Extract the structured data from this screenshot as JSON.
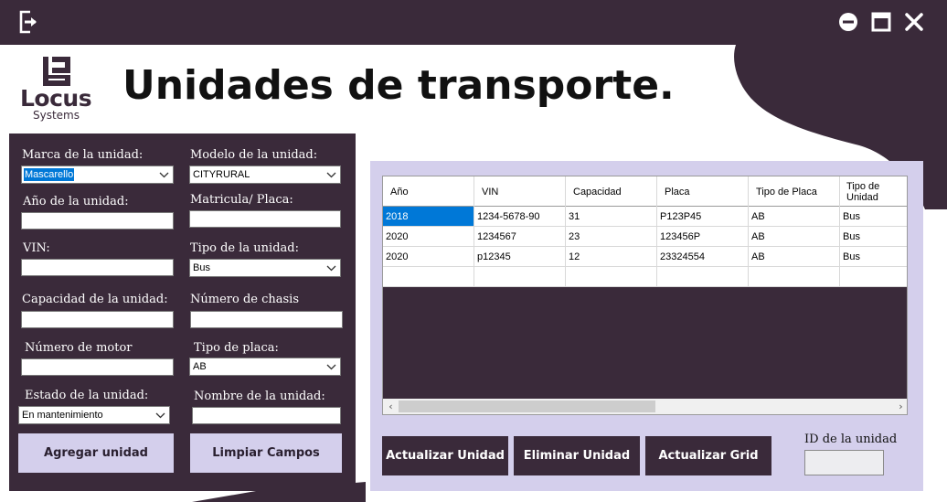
{
  "window": {
    "title_icons": [
      "logout-icon",
      "minimize-icon",
      "maximize-icon",
      "close-icon"
    ],
    "colors": {
      "titlebar": "#3a2a3a",
      "accent_light": "#d4cfec",
      "selection": "#0078d7"
    }
  },
  "logo": {
    "word": "Locus",
    "sub": "Systems"
  },
  "header": {
    "title": "Unidades de transporte."
  },
  "form": {
    "marca_label": "Marca de la unidad:",
    "marca_value": "Mascarello",
    "modelo_label": "Modelo de la unidad:",
    "modelo_value": "CITYRURAL",
    "anio_label": "Año de la unidad:",
    "anio_value": "",
    "matricula_label": "Matricula/ Placa:",
    "matricula_value": "",
    "vin_label": "VIN:",
    "vin_value": "",
    "tipo_unidad_label": "Tipo de la unidad:",
    "tipo_unidad_value": "Bus",
    "capacidad_label": "Capacidad de la unidad:",
    "capacidad_value": "",
    "chasis_label": "Número de chasis",
    "chasis_value": "",
    "motor_label": "Número de motor",
    "motor_value": "",
    "tipo_placa_label": "Tipo de placa:",
    "tipo_placa_value": "AB",
    "estado_label": "Estado de la unidad:",
    "estado_value": "En mantenimiento",
    "nombre_label": "Nombre de la unidad:",
    "nombre_value": "",
    "agregar_button": "Agregar unidad",
    "limpiar_button": "Limpiar Campos"
  },
  "grid": {
    "columns": [
      "Año",
      "VIN",
      "Capacidad",
      "Placa",
      "Tipo de Placa",
      "Tipo de Unidad"
    ],
    "rows": [
      [
        "2018",
        "1234-5678-90",
        "31",
        "P123P45",
        "AB",
        "Bus"
      ],
      [
        "2020",
        "1234567",
        "23",
        "123456P",
        "AB",
        "Bus"
      ],
      [
        "2020",
        "p12345",
        "12",
        "23324554",
        "AB",
        "Bus"
      ],
      [
        "",
        "",
        "",
        "",
        "",
        ""
      ]
    ],
    "scroll_left": "‹",
    "scroll_right": "›"
  },
  "actions": {
    "actualizar_unidad": "Actualizar Unidad",
    "eliminar_unidad": "Eliminar Unidad",
    "actualizar_grid": "Actualizar Grid",
    "id_label": "ID de la unidad",
    "id_value": ""
  }
}
